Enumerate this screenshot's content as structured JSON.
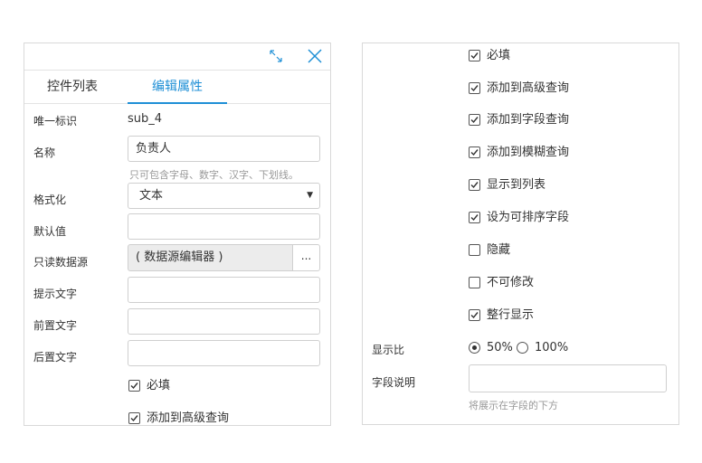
{
  "left_panel": {
    "tabs": [
      "控件列表",
      "编辑属性"
    ],
    "active_tab_index": 1,
    "unique_id_label": "唯一标识",
    "unique_id_value": "sub_4",
    "name_label": "名称",
    "name_value": "负责人",
    "name_hint": "只可包含字母、数字、汉字、下划线。",
    "format_label": "格式化",
    "format_value": "文本",
    "default_label": "默认值",
    "default_value": "",
    "readonly_source_label": "只读数据源",
    "readonly_source_value": "( 数据源编辑器 )",
    "readonly_source_button": "...",
    "placeholder_label": "提示文字",
    "placeholder_value": "",
    "prefix_label": "前置文字",
    "prefix_value": "",
    "suffix_label": "后置文字",
    "suffix_value": "",
    "checkboxes": [
      {
        "label": "必填",
        "checked": true
      },
      {
        "label": "添加到高级查询",
        "checked": true
      }
    ]
  },
  "right_panel": {
    "checkboxes": [
      {
        "label": "必填",
        "checked": true
      },
      {
        "label": "添加到高级查询",
        "checked": true
      },
      {
        "label": "添加到字段查询",
        "checked": true
      },
      {
        "label": "添加到模糊查询",
        "checked": true
      },
      {
        "label": "显示到列表",
        "checked": true
      },
      {
        "label": "设为可排序字段",
        "checked": true
      },
      {
        "label": "隐藏",
        "checked": false
      },
      {
        "label": "不可修改",
        "checked": false
      },
      {
        "label": "整行显示",
        "checked": true
      }
    ],
    "ratio_label": "显示比",
    "ratio_options": [
      {
        "label": "50%",
        "selected": true
      },
      {
        "label": "100%",
        "selected": false
      }
    ],
    "field_desc_label": "字段说明",
    "field_desc_value": "",
    "field_desc_hint": "将展示在字段的下方"
  },
  "colors": {
    "accent": "#1e8fd6",
    "border": "#d9d9d9",
    "hint": "#999999"
  },
  "icons": {
    "expand": "expand-icon",
    "close": "close-icon"
  }
}
